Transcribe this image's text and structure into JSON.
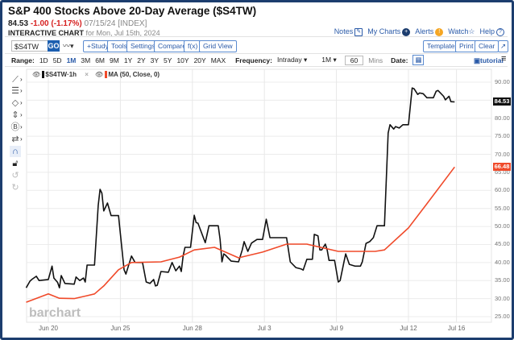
{
  "header": {
    "title": "S&P 400 Stocks Above 20-Day Average ($S4TW)",
    "last": "84.53",
    "change": "-1.00 (-1.17%)",
    "date": "07/15/24",
    "exchange": "[INDEX]",
    "chart_label": "INTERACTIVE CHART",
    "chart_for": "for Mon, Jul 15th, 2024"
  },
  "links": [
    {
      "label": "Notes",
      "icon": "edit-icon"
    },
    {
      "label": "My Charts",
      "icon": "plus-circle-icon"
    },
    {
      "label": "Alerts",
      "icon": "alert-icon"
    },
    {
      "label": "Watch",
      "icon": "star-icon"
    },
    {
      "label": "Help",
      "icon": "help-icon"
    }
  ],
  "toolbar": {
    "symbol": "$S4TW",
    "go": "GO",
    "study": "+Study",
    "tools": "Tools",
    "settings": "Settings",
    "compare": "Compare",
    "fx": "f(x)",
    "grid": "Grid View",
    "templates": "Templates",
    "print": "Print",
    "clear": "Clear",
    "expand": "↗"
  },
  "range": {
    "label": "Range:",
    "options": [
      "1D",
      "5D",
      "1M",
      "3M",
      "6M",
      "9M",
      "1Y",
      "2Y",
      "3Y",
      "5Y",
      "10Y",
      "20Y",
      "MAX"
    ],
    "selected": "1M",
    "freq_label": "Frequency:",
    "freq": "Intraday",
    "period": "1M",
    "mins": "60",
    "mins_label": "Mins",
    "date_label": "Date:",
    "tutorial": "tutorial"
  },
  "legend": {
    "series": "$S4TW·1h",
    "ma": "MA (50, Close, 0)"
  },
  "watermark": "barchart",
  "colors": {
    "price": "#111111",
    "ma": "#f04a2a",
    "accent": "#2a5aa8",
    "frame": "#1c3d6e"
  },
  "chart_data": {
    "type": "line",
    "ylim": [
      25,
      90
    ],
    "yticks": [
      "90.00",
      "85.00",
      "80.00",
      "75.00",
      "70.00",
      "65.00",
      "60.00",
      "55.00",
      "50.00",
      "45.00",
      "40.00",
      "35.00",
      "30.00",
      "25.00"
    ],
    "xticks": [
      {
        "label": "Jun 20",
        "t": "06-20 09:30"
      },
      {
        "label": "Jun 25",
        "t": "06-25 09:30"
      },
      {
        "label": "Jun 28",
        "t": "06-28 09:30"
      },
      {
        "label": "Jul 3",
        "t": "07-03 09:30"
      },
      {
        "label": "Jul 9",
        "t": "07-09 09:30"
      },
      {
        "label": "Jul 12",
        "t": "07-12 09:30"
      },
      {
        "label": "Jul 16",
        "t": "07-16 09:30"
      }
    ],
    "grid": true,
    "last_labels": {
      "price": "84.53",
      "ma": "66.48"
    },
    "series": [
      {
        "name": "$S4TW",
        "points": [
          [
            "06-18 10:00",
            33.0
          ],
          [
            "06-18 11:00",
            34.8
          ],
          [
            "06-18 11:30",
            35.3
          ],
          [
            "06-18 12:45",
            36.2
          ],
          [
            "06-18 13:30",
            35.0
          ],
          [
            "06-20 09:30",
            35.3
          ],
          [
            "06-20 10:30",
            39.0
          ],
          [
            "06-20 11:00",
            35.7
          ],
          [
            "06-20 12:00",
            34.5
          ],
          [
            "06-20 12:30",
            33.0
          ],
          [
            "06-20 13:00",
            36.4
          ],
          [
            "06-20 14:00",
            34.2
          ],
          [
            "06-21 10:00",
            34.0
          ],
          [
            "06-21 10:30",
            36.0
          ],
          [
            "06-21 11:30",
            35.0
          ],
          [
            "06-21 12:30",
            35.7
          ],
          [
            "06-21 13:00",
            34.6
          ],
          [
            "06-21 13:30",
            39.3
          ],
          [
            "06-21 15:30",
            39.3
          ],
          [
            "06-24 10:00",
            55.8
          ],
          [
            "06-24 10:30",
            60.3
          ],
          [
            "06-24 11:00",
            59.2
          ],
          [
            "06-24 11:30",
            54.3
          ],
          [
            "06-24 12:30",
            56.5
          ],
          [
            "06-24 13:30",
            53.0
          ],
          [
            "06-24 15:30",
            53.0
          ],
          [
            "06-25 10:30",
            38.0
          ],
          [
            "06-25 11:00",
            36.8
          ],
          [
            "06-25 12:30",
            41.8
          ],
          [
            "06-25 13:30",
            40.0
          ],
          [
            "06-25 15:30",
            40.0
          ],
          [
            "06-26 10:00",
            34.6
          ],
          [
            "06-26 11:00",
            34.2
          ],
          [
            "06-26 12:00",
            35.3
          ],
          [
            "06-26 12:30",
            33.5
          ],
          [
            "06-26 13:00",
            33.7
          ],
          [
            "06-26 14:00",
            37.5
          ],
          [
            "06-27 09:30",
            37.3
          ],
          [
            "06-27 10:30",
            40.0
          ],
          [
            "06-27 11:30",
            37.7
          ],
          [
            "06-27 12:30",
            39.0
          ],
          [
            "06-27 13:00",
            37.5
          ],
          [
            "06-27 13:30",
            41.8
          ],
          [
            "06-27 14:00",
            44.2
          ],
          [
            "06-27 15:30",
            44.2
          ],
          [
            "06-28 10:00",
            53.1
          ],
          [
            "06-28 10:30",
            51.1
          ],
          [
            "06-28 11:00",
            50.9
          ],
          [
            "06-28 13:00",
            45.5
          ],
          [
            "06-28 14:00",
            50.2
          ],
          [
            "07-01 10:00",
            50.2
          ],
          [
            "07-01 10:30",
            46.4
          ],
          [
            "07-01 11:00",
            40.2
          ],
          [
            "07-01 11:30",
            42.4
          ],
          [
            "07-01 12:00",
            42.0
          ],
          [
            "07-01 13:30",
            40.4
          ],
          [
            "07-01 15:30",
            40.2
          ],
          [
            "07-02 10:00",
            43.5
          ],
          [
            "07-02 10:30",
            45.8
          ],
          [
            "07-02 11:30",
            43.1
          ],
          [
            "07-02 12:30",
            45.4
          ],
          [
            "07-02 14:00",
            46.4
          ],
          [
            "07-02 15:30",
            46.4
          ],
          [
            "07-03 10:00",
            52.0
          ],
          [
            "07-03 11:00",
            46.9
          ],
          [
            "07-03 15:30",
            46.9
          ],
          [
            "07-05 10:00",
            40.2
          ],
          [
            "07-05 11:30",
            38.6
          ],
          [
            "07-05 13:00",
            38.2
          ],
          [
            "07-05 13:30",
            37.9
          ],
          [
            "07-05 14:30",
            40.9
          ],
          [
            "07-08 09:30",
            40.9
          ],
          [
            "07-08 10:00",
            47.8
          ],
          [
            "07-08 11:00",
            47.4
          ],
          [
            "07-08 11:30",
            43.5
          ],
          [
            "07-08 12:00",
            43.5
          ],
          [
            "07-08 13:00",
            45.1
          ],
          [
            "07-08 13:30",
            43.5
          ],
          [
            "07-08 14:00",
            40.6
          ],
          [
            "07-08 15:30",
            40.6
          ],
          [
            "07-09 10:00",
            34.6
          ],
          [
            "07-09 10:30",
            35.0
          ],
          [
            "07-09 11:30",
            40.0
          ],
          [
            "07-09 12:00",
            42.4
          ],
          [
            "07-09 13:00",
            39.5
          ],
          [
            "07-09 14:30",
            39.0
          ],
          [
            "07-10 09:30",
            39.0
          ],
          [
            "07-10 10:00",
            40.2
          ],
          [
            "07-10 11:00",
            45.3
          ],
          [
            "07-10 12:00",
            45.8
          ],
          [
            "07-10 13:00",
            46.9
          ],
          [
            "07-10 14:00",
            50.2
          ],
          [
            "07-11 09:30",
            50.2
          ],
          [
            "07-11 10:30",
            75.9
          ],
          [
            "07-11 11:00",
            78.2
          ],
          [
            "07-11 12:00",
            77.0
          ],
          [
            "07-11 12:30",
            77.7
          ],
          [
            "07-11 13:30",
            77.3
          ],
          [
            "07-11 14:30",
            78.2
          ],
          [
            "07-12 09:30",
            78.2
          ],
          [
            "07-12 10:30",
            88.4
          ],
          [
            "07-12 11:00",
            88.2
          ],
          [
            "07-12 12:00",
            86.6
          ],
          [
            "07-12 12:30",
            87.0
          ],
          [
            "07-12 13:30",
            86.8
          ],
          [
            "07-12 14:30",
            85.7
          ],
          [
            "07-15 09:45",
            85.7
          ],
          [
            "07-15 10:30",
            87.5
          ],
          [
            "07-15 11:00",
            87.7
          ],
          [
            "07-15 12:30",
            86.1
          ],
          [
            "07-15 13:00",
            85.1
          ],
          [
            "07-15 14:00",
            86.1
          ],
          [
            "07-15 14:30",
            84.6
          ],
          [
            "07-15 15:30",
            84.53
          ]
        ]
      },
      {
        "name": "MA (50, Close, 0)",
        "points": [
          [
            "06-18 10:00",
            29.0
          ],
          [
            "06-20 09:30",
            31.3
          ],
          [
            "06-20 12:30",
            30.1
          ],
          [
            "06-21 10:00",
            30.0
          ],
          [
            "06-21 13:30",
            30.8
          ],
          [
            "06-21 15:30",
            31.3
          ],
          [
            "06-24 11:30",
            33.5
          ],
          [
            "06-24 15:30",
            38.0
          ],
          [
            "06-25 12:30",
            40.0
          ],
          [
            "06-26 14:00",
            40.2
          ],
          [
            "06-27 12:30",
            41.5
          ],
          [
            "06-28 10:00",
            43.5
          ],
          [
            "06-28 15:30",
            44.2
          ],
          [
            "07-01 15:30",
            41.3
          ],
          [
            "07-02 15:30",
            42.9
          ],
          [
            "07-03 15:30",
            45.1
          ],
          [
            "07-05 14:30",
            45.1
          ],
          [
            "07-09 10:00",
            43.1
          ],
          [
            "07-09 14:30",
            43.1
          ],
          [
            "07-10 13:30",
            43.1
          ],
          [
            "07-11 09:30",
            43.5
          ],
          [
            "07-12 09:30",
            49.6
          ],
          [
            "07-12 14:30",
            56.3
          ],
          [
            "07-15 15:30",
            66.48
          ]
        ]
      }
    ]
  }
}
